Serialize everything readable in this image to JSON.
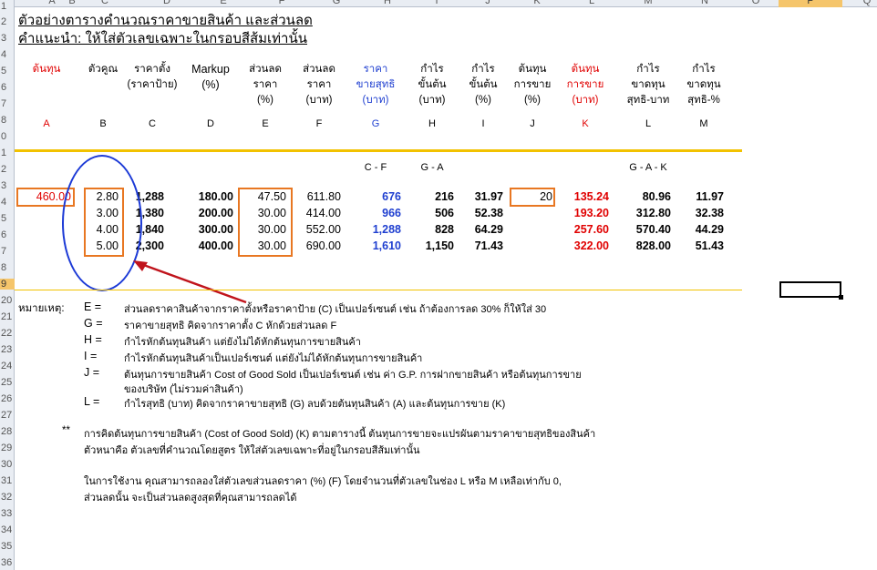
{
  "columns": [
    "A",
    "B",
    "C",
    "D",
    "E",
    "F",
    "G",
    "H",
    "I",
    "J",
    "K",
    "L",
    "M",
    "N",
    "O",
    "P",
    "Q"
  ],
  "selected_column": "P",
  "rows": [
    "1",
    "2",
    "3",
    "4",
    "5",
    "6",
    "7",
    "8",
    "9",
    "10",
    "11",
    "12",
    "13",
    "14",
    "15",
    "16",
    "17",
    "18",
    "19",
    "20",
    "21",
    "22",
    "23",
    "24",
    "25",
    "26",
    "27",
    "28",
    "29",
    "30",
    "31",
    "32",
    "33",
    "34",
    "35",
    "36"
  ],
  "row_labels_visible": [
    "1",
    "2",
    "3",
    "4",
    "5",
    "6",
    "7",
    "8",
    "0",
    "1",
    "2",
    "3",
    "4",
    "5",
    "6",
    "7",
    "8",
    "9",
    "20",
    "21",
    "22",
    "23",
    "24",
    "25",
    "26",
    "27",
    "28",
    "29",
    "30",
    "31",
    "32",
    "33",
    "34",
    "35",
    "36"
  ],
  "selected_row": "9",
  "title": "ตัวอย่างตารางคำนวณราคาขายสินค้า และส่วนลด",
  "instruction": "คำแนะนำ:   ให้ใส่ตัวเลขเฉพาะในกรอบสีส้มเท่านั้น",
  "headers": [
    {
      "text": "ต้นทุน",
      "color": "red"
    },
    {
      "text": "ตัวคูณ",
      "color": "black"
    },
    {
      "text": "ราคาตั้ง\n(ราคาป้าย)",
      "color": "black"
    },
    {
      "text": "Markup\n(%)",
      "color": "black"
    },
    {
      "text": "ส่วนลด\nราคา\n(%)",
      "color": "black"
    },
    {
      "text": "ส่วนลด\nราคา\n(บาท)",
      "color": "black"
    },
    {
      "text": "ราคา\nขายสุทธิ\n(บาท)",
      "color": "blue"
    },
    {
      "text": "กำไร\nขั้นต้น\n(บาท)",
      "color": "black"
    },
    {
      "text": "กำไร\nขั้นต้น\n(%)",
      "color": "black"
    },
    {
      "text": "ต้นทุน\nการขาย\n(%)",
      "color": "black"
    },
    {
      "text": "ต้นทุน\nการขาย\n(บาท)",
      "color": "red"
    },
    {
      "text": "กำไร\nขาดทุน\nสุทธิ-บาท",
      "color": "black"
    },
    {
      "text": "กำไร\nขาดทุน\nสุทธิ-%",
      "color": "black"
    }
  ],
  "letters": [
    "A",
    "B",
    "C",
    "D",
    "E",
    "F",
    "G",
    "H",
    "I",
    "J",
    "K",
    "L",
    "M"
  ],
  "formulas": {
    "g": "C - F",
    "h": "G - A",
    "l": "G - A - K"
  },
  "data_rows": [
    {
      "a": "460.00",
      "b": "2.80",
      "c": "1,288",
      "d": "180.00",
      "e": "47.50",
      "f": "611.80",
      "g": "676",
      "h": "216",
      "i": "31.97",
      "j": "20",
      "k": "135.24",
      "l": "80.96",
      "m": "11.97"
    },
    {
      "a": "",
      "b": "3.00",
      "c": "1,380",
      "d": "200.00",
      "e": "30.00",
      "f": "414.00",
      "g": "966",
      "h": "506",
      "i": "52.38",
      "j": "",
      "k": "193.20",
      "l": "312.80",
      "m": "32.38"
    },
    {
      "a": "",
      "b": "4.00",
      "c": "1,840",
      "d": "300.00",
      "e": "30.00",
      "f": "552.00",
      "g": "1,288",
      "h": "828",
      "i": "64.29",
      "j": "",
      "k": "257.60",
      "l": "570.40",
      "m": "44.29"
    },
    {
      "a": "",
      "b": "5.00",
      "c": "2,300",
      "d": "400.00",
      "e": "30.00",
      "f": "690.00",
      "g": "1,610",
      "h": "1,150",
      "i": "71.43",
      "j": "",
      "k": "322.00",
      "l": "828.00",
      "m": "51.43"
    }
  ],
  "notes_label": "หมายเหตุ:",
  "notes": [
    {
      "key": "E =",
      "text": "ส่วนลดราคาสินค้าจากราคาตั้งหรือราคาป้าย (C) เป็นเปอร์เซนต์ เช่น ถ้าต้องการลด 30%  ก็ให้ใส่ 30"
    },
    {
      "key": "G =",
      "text": "ราคาขายสุทธิ  คิดจากราคาตั้ง C  หักด้วยส่วนลด F"
    },
    {
      "key": "H =",
      "text": "กำไรหักต้นทุนสินค้า แต่ยังไม่ได้หักต้นทุนการขายสินค้า"
    },
    {
      "key": "I =",
      "text": "กำไรหักต้นทุนสินค้าเป็นเปอร์เซนต์  แต่ยังไม่ได้หักต้นทุนการขายสินค้า"
    },
    {
      "key": "J =",
      "text": "ต้นทุนการขายสินค้า Cost of Good Sold  เป็นเปอร์เซนต์  เช่น ค่า G.P. การฝากขายสินค้า  หรือต้นทุนการขาย"
    },
    {
      "key": "",
      "text": "ของบริษัท (ไม่รวมค่าสินค้า)"
    },
    {
      "key": "L =",
      "text": "กำไรสุทธิ (บาท)  คิดจากราคาขายสุทธิ (G)  ลบด้วยต้นทุนสินค้า (A) และต้นทุนการขาย (K)"
    }
  ],
  "footnote_mark": "**",
  "footnotes": [
    "การคิดต้นทุนการขายสินค้า (Cost of Good Sold)  (K)   ตามตารางนี้ ต้นทุนการขายจะแปรผันตามราคาขายสุทธิของสินค้า",
    "ตัวหนาคือ ตัวเลขที่คำนวณโดยสูตร  ให้ใส่ตัวเลขเฉพาะที่อยู่ในกรอบสีส้มเท่านั้น",
    "",
    "ในการใช้งาน  คุณสามารถลองใส่ตัวเลขส่วนลดราคา (%)  (F)  โดยจำนวนที่ตัวเลขในช่อง L หรือ M เหลือเท่ากับ 0,",
    "ส่วนลดนั้น จะเป็นส่วนลดสูงสุดที่คุณสามารถลดได้"
  ]
}
